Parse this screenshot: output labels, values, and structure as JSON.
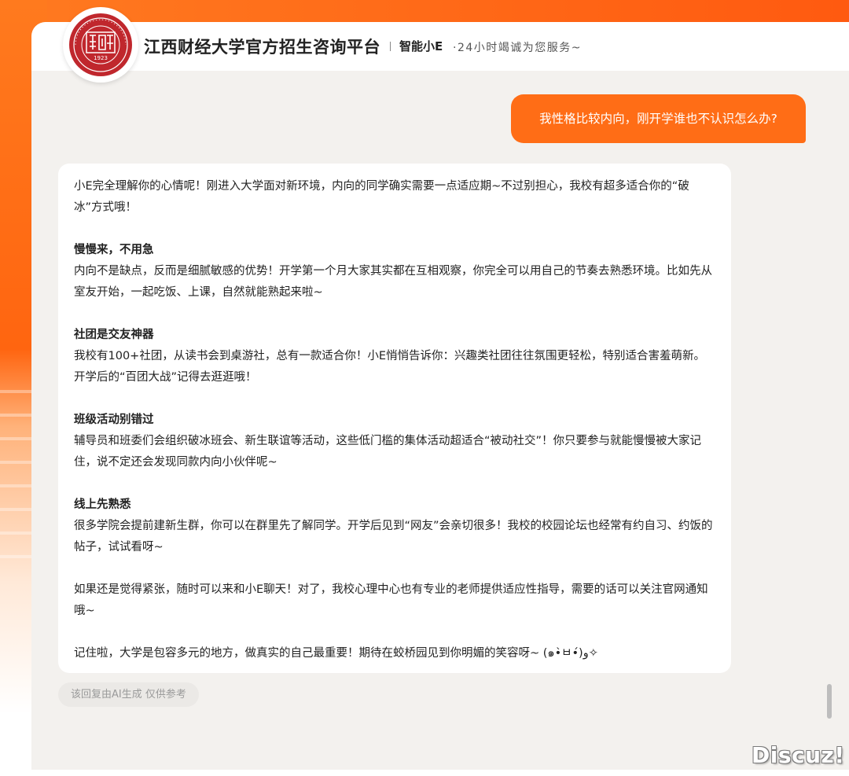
{
  "header": {
    "title": "江西财经大学官方招生咨询平台",
    "brand": "智能小E",
    "slogan": "·24小时竭诚为您服务~",
    "logo_year": "1923"
  },
  "chat": {
    "user_message": "我性格比较内向，刚开学谁也不认识怎么办?",
    "answer": {
      "intro": "小E完全理解你的心情呢！刚进入大学面对新环境，内向的同学确实需要一点适应期~不过别担心，我校有超多适合你的“破冰”方式哦！",
      "sections": [
        {
          "heading": "慢慢来，不用急",
          "body": "内向不是缺点，反而是细腻敏感的优势！开学第一个月大家其实都在互相观察，你完全可以用自己的节奏去熟悉环境。比如先从室友开始，一起吃饭、上课，自然就能熟起来啦~"
        },
        {
          "heading": "社团是交友神器",
          "body": "我校有100+社团，从读书会到桌游社，总有一款适合你！小E悄悄告诉你：兴趣类社团往往氛围更轻松，特别适合害羞萌新。开学后的“百团大战”记得去逛逛哦！"
        },
        {
          "heading": "班级活动别错过",
          "body": "辅导员和班委们会组织破冰班会、新生联谊等活动，这些低门槛的集体活动超适合“被动社交”！你只要参与就能慢慢被大家记住，说不定还会发现同款内向小伙伴呢~"
        },
        {
          "heading": "线上先熟悉",
          "body": "很多学院会提前建新生群，你可以在群里先了解同学。开学后见到“网友”会亲切很多！我校的校园论坛也经常有约自习、约饭的帖子，试试看呀~"
        }
      ],
      "closing1": "如果还是觉得紧张，随时可以来和小E聊天！对了，我校心理中心也有专业的老师提供适应性指导，需要的话可以关注官网通知哦~",
      "closing2": "记住啦，大学是包容多元的地方，做真实的自己最重要！期待在蛟桥园见到你明媚的笑容呀~ (๑•̀ㅂ•́)و✧"
    },
    "disclaimer": "该回复由AI生成 仅供参考"
  },
  "watermark": "Discuz!",
  "colors": {
    "accent": "#ff6d16",
    "logo_red": "#c0272d"
  },
  "icons": {
    "logo": "university-seal-icon"
  }
}
